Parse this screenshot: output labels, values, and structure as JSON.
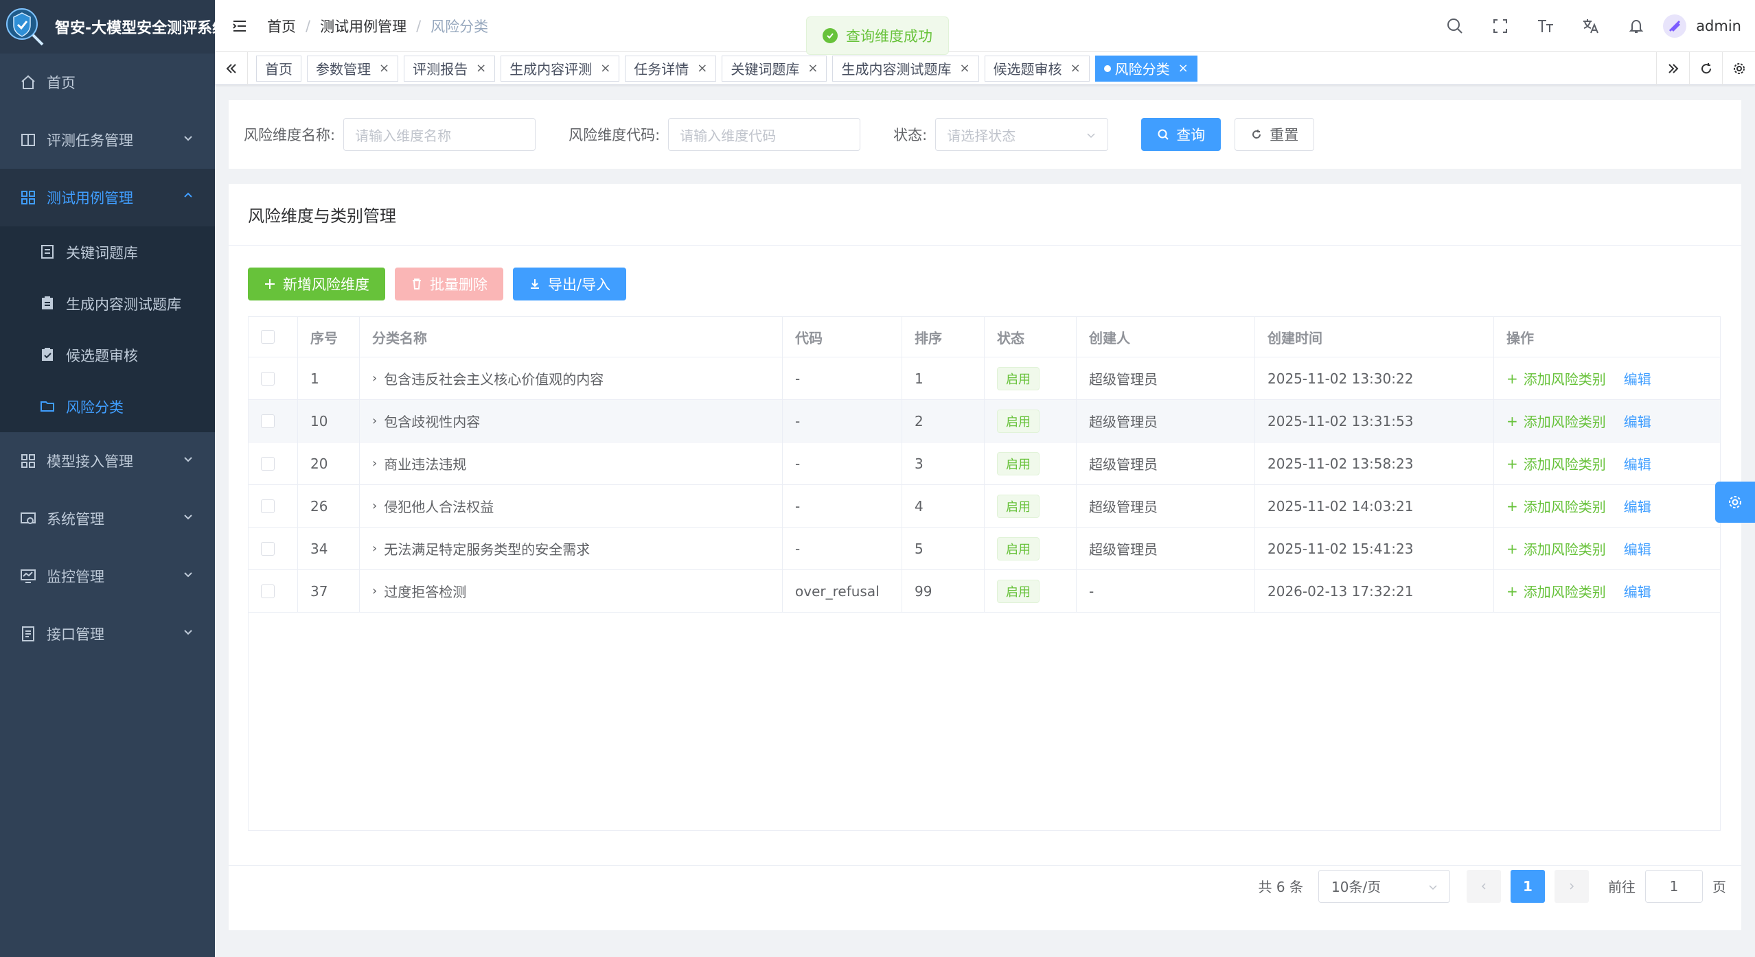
{
  "app": {
    "title": "智安-大模型安全测评系统"
  },
  "sidebar": {
    "items": [
      {
        "label": "首页",
        "icon": "home-icon"
      },
      {
        "label": "评测任务管理",
        "icon": "book-icon"
      },
      {
        "label": "测试用例管理",
        "icon": "grid-icon"
      },
      {
        "label": "模型接入管理",
        "icon": "grid-icon"
      },
      {
        "label": "系统管理",
        "icon": "system-icon"
      },
      {
        "label": "监控管理",
        "icon": "monitor-icon"
      },
      {
        "label": "接口管理",
        "icon": "document-icon"
      }
    ],
    "subitems": [
      {
        "label": "关键词题库",
        "icon": "list-icon"
      },
      {
        "label": "生成内容测试题库",
        "icon": "clipboard-icon"
      },
      {
        "label": "候选题审核",
        "icon": "clipboard-check-icon"
      },
      {
        "label": "风险分类",
        "icon": "folder-icon"
      }
    ]
  },
  "breadcrumb": [
    "首页",
    "测试用例管理",
    "风险分类"
  ],
  "user": {
    "name": "admin"
  },
  "toast": {
    "message": "查询维度成功"
  },
  "tags": [
    "首页",
    "参数管理",
    "评测报告",
    "生成内容评测",
    "任务详情",
    "关键词题库",
    "生成内容测试题库",
    "候选题审核",
    "风险分类"
  ],
  "search": {
    "name_label": "风险维度名称:",
    "name_placeholder": "请输入维度名称",
    "code_label": "风险维度代码:",
    "code_placeholder": "请输入维度代码",
    "status_label": "状态:",
    "status_placeholder": "请选择状态",
    "query_button": "查询",
    "reset_button": "重置"
  },
  "card": {
    "title": "风险维度与类别管理"
  },
  "toolbar": {
    "add": "新增风险维度",
    "batch_delete": "批量删除",
    "export_import": "导出/导入"
  },
  "table": {
    "columns": [
      "序号",
      "分类名称",
      "代码",
      "排序",
      "状态",
      "创建人",
      "创建时间",
      "操作"
    ],
    "rows": [
      {
        "id": "1",
        "name": "包含违反社会主义核心价值观的内容",
        "code": "-",
        "sort": "1",
        "status": "启用",
        "creator": "超级管理员",
        "created": "2025-11-02 13:30:22"
      },
      {
        "id": "10",
        "name": "包含歧视性内容",
        "code": "-",
        "sort": "2",
        "status": "启用",
        "creator": "超级管理员",
        "created": "2025-11-02 13:31:53"
      },
      {
        "id": "20",
        "name": "商业违法违规",
        "code": "-",
        "sort": "3",
        "status": "启用",
        "creator": "超级管理员",
        "created": "2025-11-02 13:58:23"
      },
      {
        "id": "26",
        "name": "侵犯他人合法权益",
        "code": "-",
        "sort": "4",
        "status": "启用",
        "creator": "超级管理员",
        "created": "2025-11-02 14:03:21"
      },
      {
        "id": "34",
        "name": "无法满足特定服务类型的安全需求",
        "code": "-",
        "sort": "5",
        "status": "启用",
        "creator": "超级管理员",
        "created": "2025-11-02 15:41:23"
      },
      {
        "id": "37",
        "name": "过度拒答检测",
        "code": "over_refusal",
        "sort": "99",
        "status": "启用",
        "creator": "-",
        "created": "2026-02-13 17:32:21"
      }
    ],
    "op_add": "添加风险类别",
    "op_edit": "编辑"
  },
  "pagination": {
    "total": "共 6 条",
    "page_size": "10条/页",
    "current_page": "1",
    "goto_label": "前往",
    "goto_value": "1",
    "goto_suffix": "页"
  },
  "colors": {
    "primary": "#409eff",
    "success": "#67c23a",
    "sidebar_bg": "#304156"
  }
}
